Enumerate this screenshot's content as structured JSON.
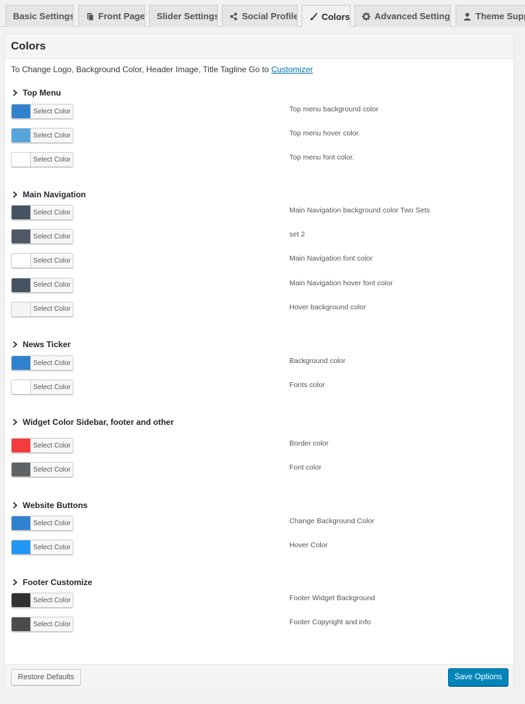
{
  "tabs": [
    {
      "label": "Basic Settings",
      "icon": ""
    },
    {
      "label": "Front Page",
      "icon": "page-icon"
    },
    {
      "label": "Slider Settings",
      "icon": ""
    },
    {
      "label": "Social Profile",
      "icon": "share-icon"
    },
    {
      "label": "Colors",
      "icon": "brush-icon",
      "active": true
    },
    {
      "label": "Advanced Settings",
      "icon": "gear-icon"
    },
    {
      "label": "Theme Support",
      "icon": "user-icon"
    }
  ],
  "panel": {
    "title": "Colors",
    "intro_text": "To Change Logo, Background Color, Header Image, Title Tagline Go to ",
    "intro_link": "Customizer"
  },
  "picker_label": "Select Color",
  "sections": [
    {
      "title": "Top Menu",
      "items": [
        {
          "color": "#3182ce",
          "desc": "Top menu background color"
        },
        {
          "color": "#56a6dc",
          "desc": "Top menu hover color."
        },
        {
          "color": "#ffffff",
          "desc": "Top menu font color."
        }
      ]
    },
    {
      "title": "Main Navigation",
      "items": [
        {
          "color": "#465361",
          "desc": "Main Navigation background color Two Sets"
        },
        {
          "color": "#4e5866",
          "desc": "set 2"
        },
        {
          "color": "#ffffff",
          "desc": "Main Navigation font color"
        },
        {
          "color": "#465361",
          "desc": "Main Navigation hover font color"
        },
        {
          "color": "#f5f5f5",
          "desc": "Hover background color"
        }
      ]
    },
    {
      "title": "News Ticker",
      "items": [
        {
          "color": "#3182ce",
          "desc": "Background color"
        },
        {
          "color": "#ffffff",
          "desc": "Fonts color"
        }
      ]
    },
    {
      "title": "Widget Color Sidebar, footer and other",
      "items": [
        {
          "color": "#f53b3b",
          "desc": "Border color"
        },
        {
          "color": "#606366",
          "desc": "Font color"
        }
      ]
    },
    {
      "title": "Website Buttons",
      "items": [
        {
          "color": "#3182ce",
          "desc": "Change Background Color"
        },
        {
          "color": "#2196f3",
          "desc": "Hover Color"
        }
      ]
    },
    {
      "title": "Footer Customize",
      "items": [
        {
          "color": "#2f3133",
          "desc": "Footer Widget Background"
        },
        {
          "color": "#4a4b4d",
          "desc": "Footer Copyright and info"
        }
      ]
    }
  ],
  "footer": {
    "restore_label": "Restore Defaults",
    "save_label": "Save Options"
  }
}
